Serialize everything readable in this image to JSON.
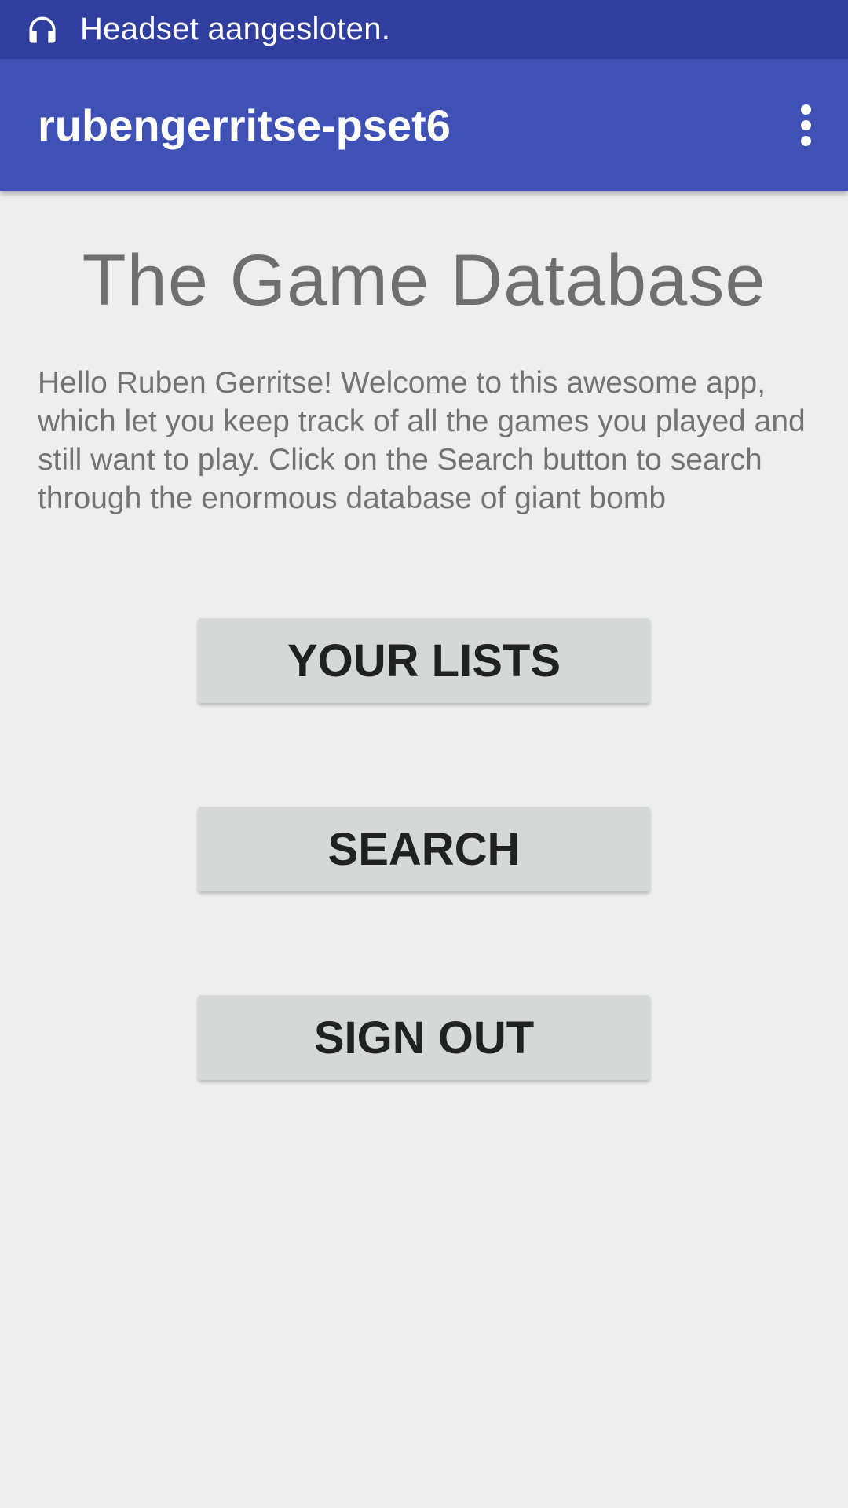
{
  "status_bar": {
    "icon": "headset-icon",
    "text": "Headset aangesloten.",
    "background": "#303f9f"
  },
  "app_bar": {
    "title": "rubengerritse-pset6",
    "overflow_icon": "more-vert-icon",
    "background": "#3f51b5"
  },
  "main": {
    "heading": "The Game Database",
    "welcome_text": "Hello Ruben Gerritse! Welcome to this awesome app, which let you keep track of all the games you played and still want to play. Click on the Search button to search through the enormous database of giant bomb",
    "buttons": {
      "your_lists": "YOUR LISTS",
      "search": "SEARCH",
      "sign_out": "SIGN OUT"
    }
  }
}
